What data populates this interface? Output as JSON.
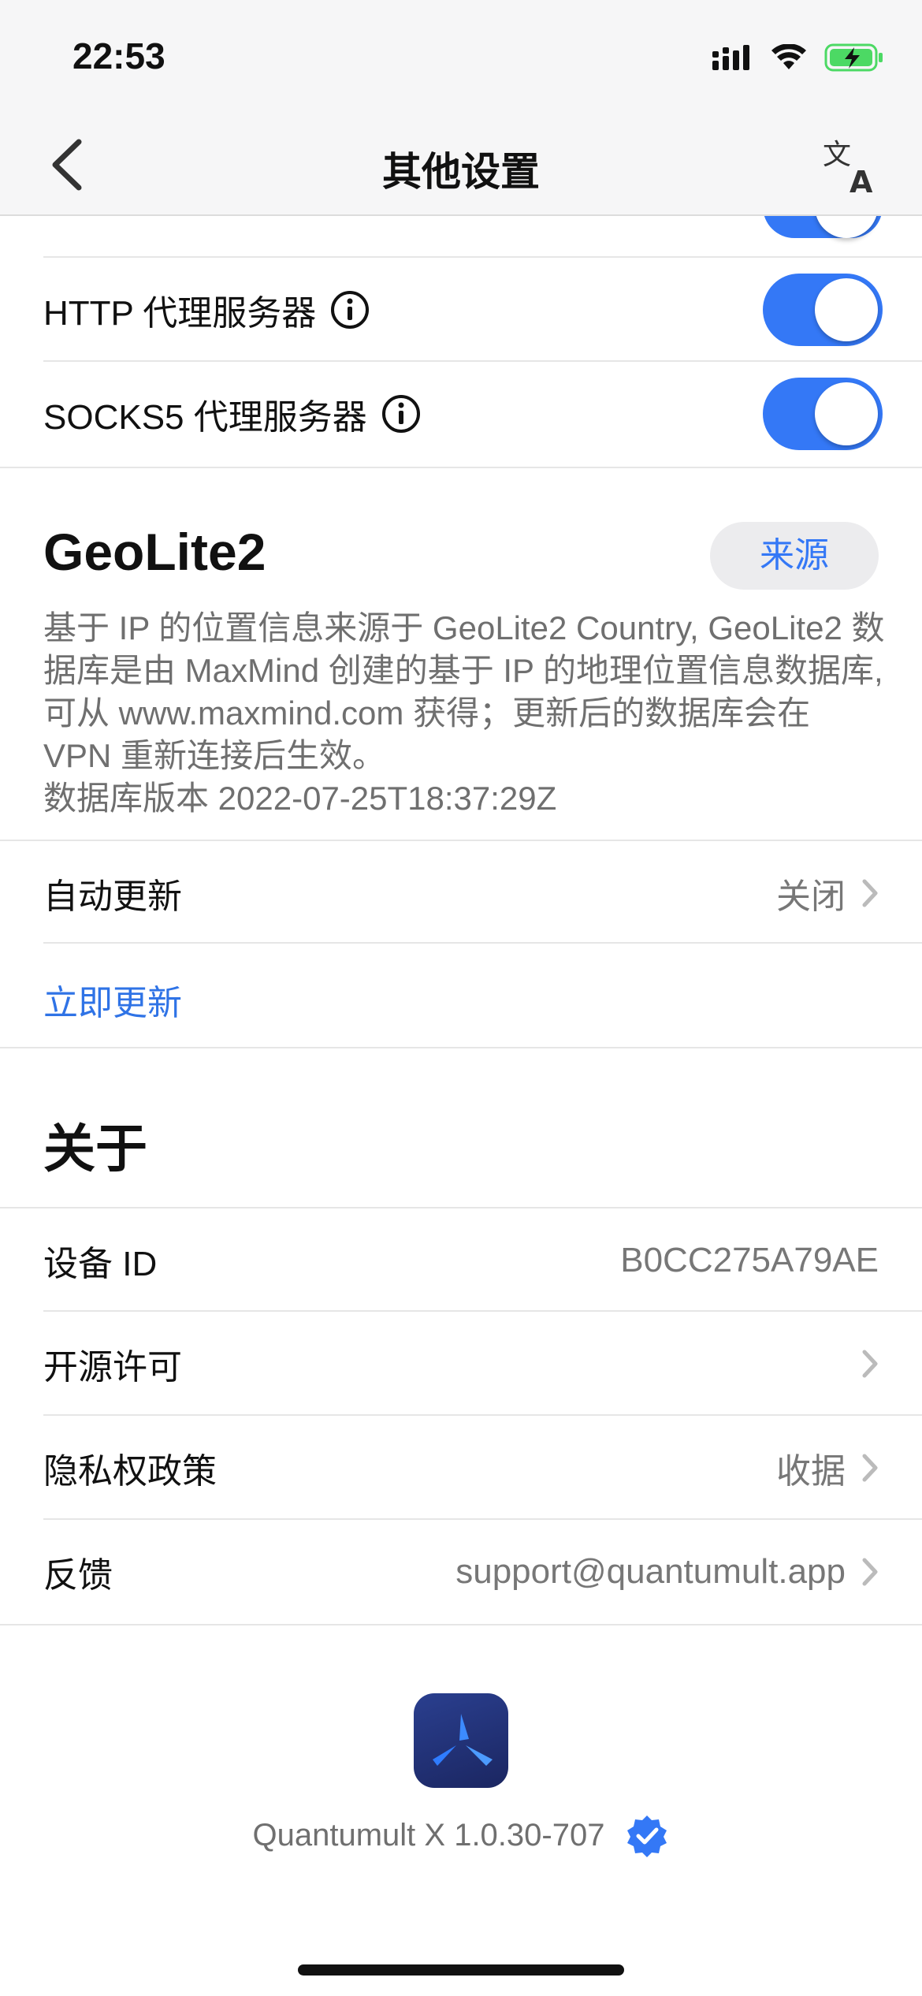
{
  "status_bar": {
    "time": "22:53"
  },
  "nav": {
    "title": "其他设置"
  },
  "toggles": [
    {
      "label": "HTTP 代理服务器",
      "on": true
    },
    {
      "label": "SOCKS5 代理服务器",
      "on": true
    }
  ],
  "geolite": {
    "title": "GeoLite2",
    "source_button": "来源",
    "description": "基于 IP 的位置信息来源于 GeoLite2 Country, GeoLite2 数据库是由 MaxMind 创建的基于 IP 的地理位置信息数据库, 可从 www.maxmind.com 获得；更新后的数据库会在 VPN 重新连接后生效。",
    "db_version": "数据库版本 2022-07-25T18:37:29Z",
    "auto_update": {
      "label": "自动更新",
      "value": "关闭"
    },
    "update_now": "立即更新"
  },
  "about": {
    "title": "关于",
    "device_id": {
      "label": "设备 ID",
      "value": "B0CC275A79AE"
    },
    "open_source": {
      "label": "开源许可"
    },
    "privacy": {
      "label": "隐私权政策",
      "value": "收据"
    },
    "feedback": {
      "label": "反馈",
      "value": "support@quantumult.app"
    }
  },
  "footer": {
    "version": "Quantumult X 1.0.30-707"
  },
  "colors": {
    "accent": "#3478f6",
    "toggle_on": "#3478f6",
    "secondary_text": "#6f6f6f"
  }
}
